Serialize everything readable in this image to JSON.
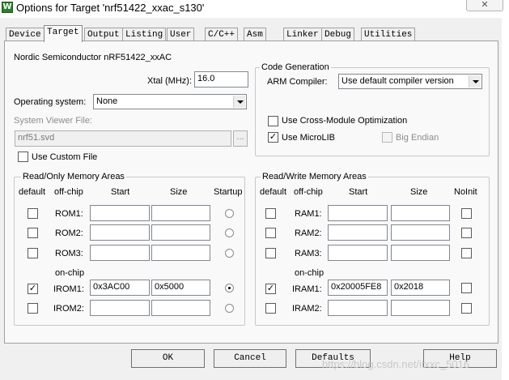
{
  "window": {
    "title": "Options for Target 'nrf51422_xxac_s130'",
    "icon_letter": "W",
    "close_glyph": "✕"
  },
  "tabs": [
    "Device",
    "Target",
    "Output",
    "Listing",
    "User",
    "C/C++",
    "Asm",
    "Linker",
    "Debug",
    "Utilities"
  ],
  "active_tab": "Target",
  "device_name": "Nordic Semiconductor nRF51422_xxAC",
  "xtal": {
    "label": "Xtal (MHz):",
    "value": "16.0"
  },
  "os": {
    "label": "Operating system:",
    "value": "None"
  },
  "svd": {
    "label": "System Viewer File:",
    "value": "nrf51.svd",
    "browse": "..."
  },
  "custom_file": {
    "label": "Use Custom File",
    "checked": false
  },
  "codegen": {
    "title": "Code Generation",
    "compiler_label": "ARM Compiler:",
    "compiler_value": "Use default compiler version",
    "cross_module": {
      "label": "Use Cross-Module Optimization",
      "checked": false
    },
    "microlib": {
      "label": "Use MicroLIB",
      "checked": true,
      "mark": "✓"
    },
    "big_endian": {
      "label": "Big Endian",
      "checked": false
    }
  },
  "ro_memory": {
    "title": "Read/Only Memory Areas",
    "headers": {
      "default": "default",
      "offchip": "off-chip",
      "start": "Start",
      "size": "Size",
      "startup": "Startup"
    },
    "onchip_label": "on-chip",
    "rows": [
      {
        "name": "ROM1:",
        "start": "",
        "size": "",
        "default": false,
        "startup": false
      },
      {
        "name": "ROM2:",
        "start": "",
        "size": "",
        "default": false,
        "startup": false
      },
      {
        "name": "ROM3:",
        "start": "",
        "size": "",
        "default": false,
        "startup": false
      },
      {
        "name": "IROM1:",
        "start": "0x3AC00",
        "size": "0x5000",
        "default": true,
        "startup": true
      },
      {
        "name": "IROM2:",
        "start": "",
        "size": "",
        "default": false,
        "startup": false
      }
    ]
  },
  "rw_memory": {
    "title": "Read/Write Memory Areas",
    "headers": {
      "default": "default",
      "offchip": "off-chip",
      "start": "Start",
      "size": "Size",
      "noinit": "NoInit"
    },
    "onchip_label": "on-chip",
    "rows": [
      {
        "name": "RAM1:",
        "start": "",
        "size": "",
        "default": false,
        "noinit": false
      },
      {
        "name": "RAM2:",
        "start": "",
        "size": "",
        "default": false,
        "noinit": false
      },
      {
        "name": "RAM3:",
        "start": "",
        "size": "",
        "default": false,
        "noinit": false
      },
      {
        "name": "IRAM1:",
        "start": "0x20005FE8",
        "size": "0x2018",
        "default": true,
        "noinit": false
      },
      {
        "name": "IRAM2:",
        "start": "",
        "size": "",
        "default": false,
        "noinit": false
      }
    ]
  },
  "buttons": {
    "ok": "OK",
    "cancel": "Cancel",
    "defaults": "Defaults",
    "help": "Help"
  },
  "watermark": "https://blog.csdn.net/itxxc_5016",
  "check_mark": "✓"
}
